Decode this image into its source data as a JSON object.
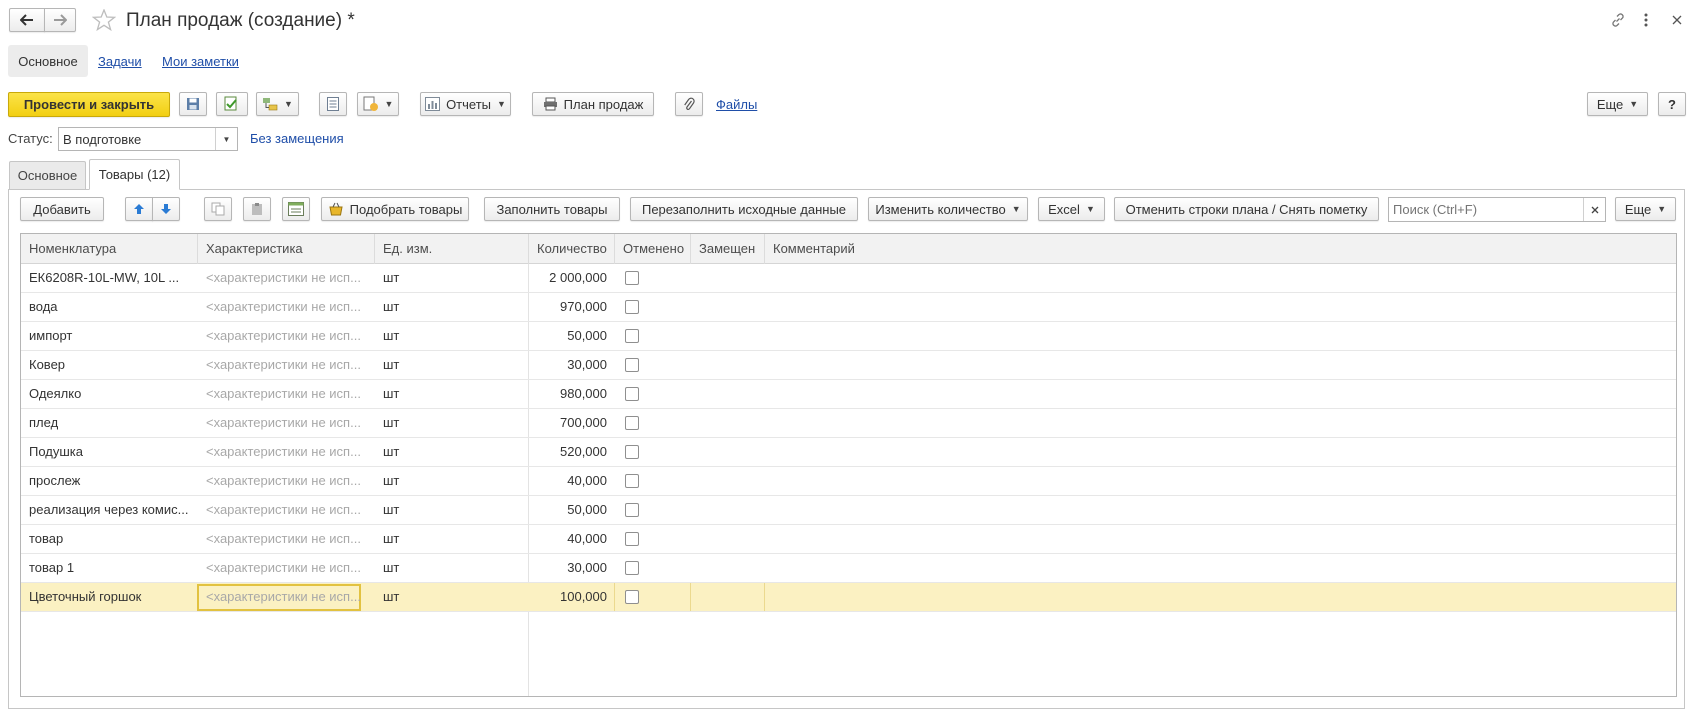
{
  "window": {
    "title": "План продаж (создание) *"
  },
  "top_tabs": [
    "Основное",
    "Задачи",
    "Мои заметки"
  ],
  "toolbar": {
    "post_close": "Провести и закрыть",
    "reports": "Отчеты",
    "print_plan": "План продаж",
    "files": "Файлы",
    "more": "Еще",
    "help": "?"
  },
  "status": {
    "label": "Статус:",
    "value": "В подготовке",
    "link": "Без замещения"
  },
  "inner_tabs": [
    "Основное",
    "Товары (12)"
  ],
  "table_toolbar": {
    "add": "Добавить",
    "pick_goods": "Подобрать товары",
    "fill_goods": "Заполнить товары",
    "refill": "Перезаполнить исходные данные",
    "change_qty": "Изменить количество",
    "excel": "Excel",
    "cancel_rows": "Отменить строки плана / Снять пометку",
    "search_placeholder": "Поиск (Ctrl+F)",
    "more": "Еще"
  },
  "columns": [
    "Номенклатура",
    "Характеристика",
    "Ед. изм.",
    "Количество",
    "Отменено",
    "Замещен",
    "Комментарий"
  ],
  "rows": [
    {
      "item": "ЕК6208R-10L-MW, 10L ...",
      "characteristic": "<характеристики не исп...",
      "unit": "шт",
      "qty": "2 000,000",
      "canceled": false,
      "replaced": "",
      "comment": ""
    },
    {
      "item": "вода",
      "characteristic": "<характеристики не исп...",
      "unit": "шт",
      "qty": "970,000",
      "canceled": false,
      "replaced": "",
      "comment": ""
    },
    {
      "item": "импорт",
      "characteristic": "<характеристики не исп...",
      "unit": "шт",
      "qty": "50,000",
      "canceled": false,
      "replaced": "",
      "comment": ""
    },
    {
      "item": "Ковер",
      "characteristic": "<характеристики не исп...",
      "unit": "шт",
      "qty": "30,000",
      "canceled": false,
      "replaced": "",
      "comment": ""
    },
    {
      "item": "Одеялко",
      "characteristic": "<характеристики не исп...",
      "unit": "шт",
      "qty": "980,000",
      "canceled": false,
      "replaced": "",
      "comment": ""
    },
    {
      "item": "плед",
      "characteristic": "<характеристики не исп...",
      "unit": "шт",
      "qty": "700,000",
      "canceled": false,
      "replaced": "",
      "comment": ""
    },
    {
      "item": "Подушка",
      "characteristic": "<характеристики не исп...",
      "unit": "шт",
      "qty": "520,000",
      "canceled": false,
      "replaced": "",
      "comment": ""
    },
    {
      "item": "прослеж",
      "characteristic": "<характеристики не исп...",
      "unit": "шт",
      "qty": "40,000",
      "canceled": false,
      "replaced": "",
      "comment": ""
    },
    {
      "item": "реализация через комис...",
      "characteristic": "<характеристики не исп...",
      "unit": "шт",
      "qty": "50,000",
      "canceled": false,
      "replaced": "",
      "comment": ""
    },
    {
      "item": "товар",
      "characteristic": "<характеристики не исп...",
      "unit": "шт",
      "qty": "40,000",
      "canceled": false,
      "replaced": "",
      "comment": ""
    },
    {
      "item": "товар 1",
      "characteristic": "<характеристики не исп...",
      "unit": "шт",
      "qty": "30,000",
      "canceled": false,
      "replaced": "",
      "comment": ""
    },
    {
      "item": "Цветочный горшок",
      "characteristic": "<характеристики не исп...",
      "unit": "шт",
      "qty": "100,000",
      "canceled": false,
      "replaced": "",
      "comment": "",
      "selected": true
    }
  ],
  "colors": {
    "primary_button": "#f7d92a",
    "selection_row": "#fbf1c2",
    "selection_border": "#e2c240",
    "link": "#1f4ea8"
  }
}
